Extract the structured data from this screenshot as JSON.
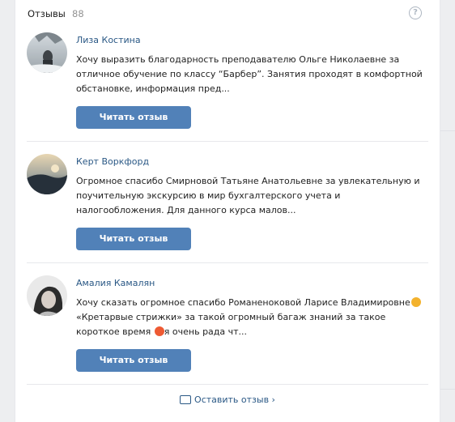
{
  "header": {
    "title": "Отзывы",
    "count": "88",
    "help_icon": "question-circle-icon"
  },
  "reviews": [
    {
      "name": "Лиза Костина",
      "text": "Хочу выразить благодарность преподавателю Ольге Николаевне за отличное обучение по классу “Барбер”. Занятия проходят в комфортной обстановке, информация пред...",
      "button": "Читать отзыв",
      "avatar_colors": [
        "#bfc6cc",
        "#5c6266"
      ]
    },
    {
      "name": "Керт Воркфорд",
      "text": "Огромное спасибо Смирновой Татьяне Анатольевне за увлекательную и поучительную экскурсию в мир бухгалтерского учета и налогообложения. Для данного курса малов...",
      "button": "Читать отзыв",
      "avatar_colors": [
        "#d9c9a8",
        "#3b4a5a"
      ]
    },
    {
      "name": "Амалия Камалян",
      "text_parts": [
        "Хочу сказать огромное спасибо Романеноковой Ларисе Владимировне",
        "«Кретарвые стрижки» за такой огромный багаж знаний за такое короткое время ",
        "я очень рада чт..."
      ],
      "button": "Читать отзыв",
      "avatar_colors": [
        "#e6e6e6",
        "#303030"
      ]
    }
  ],
  "footer": {
    "label": "Оставить отзыв ›",
    "icon": "comment-icon"
  },
  "colors": {
    "accent": "#5181b8",
    "link": "#2a5885"
  }
}
